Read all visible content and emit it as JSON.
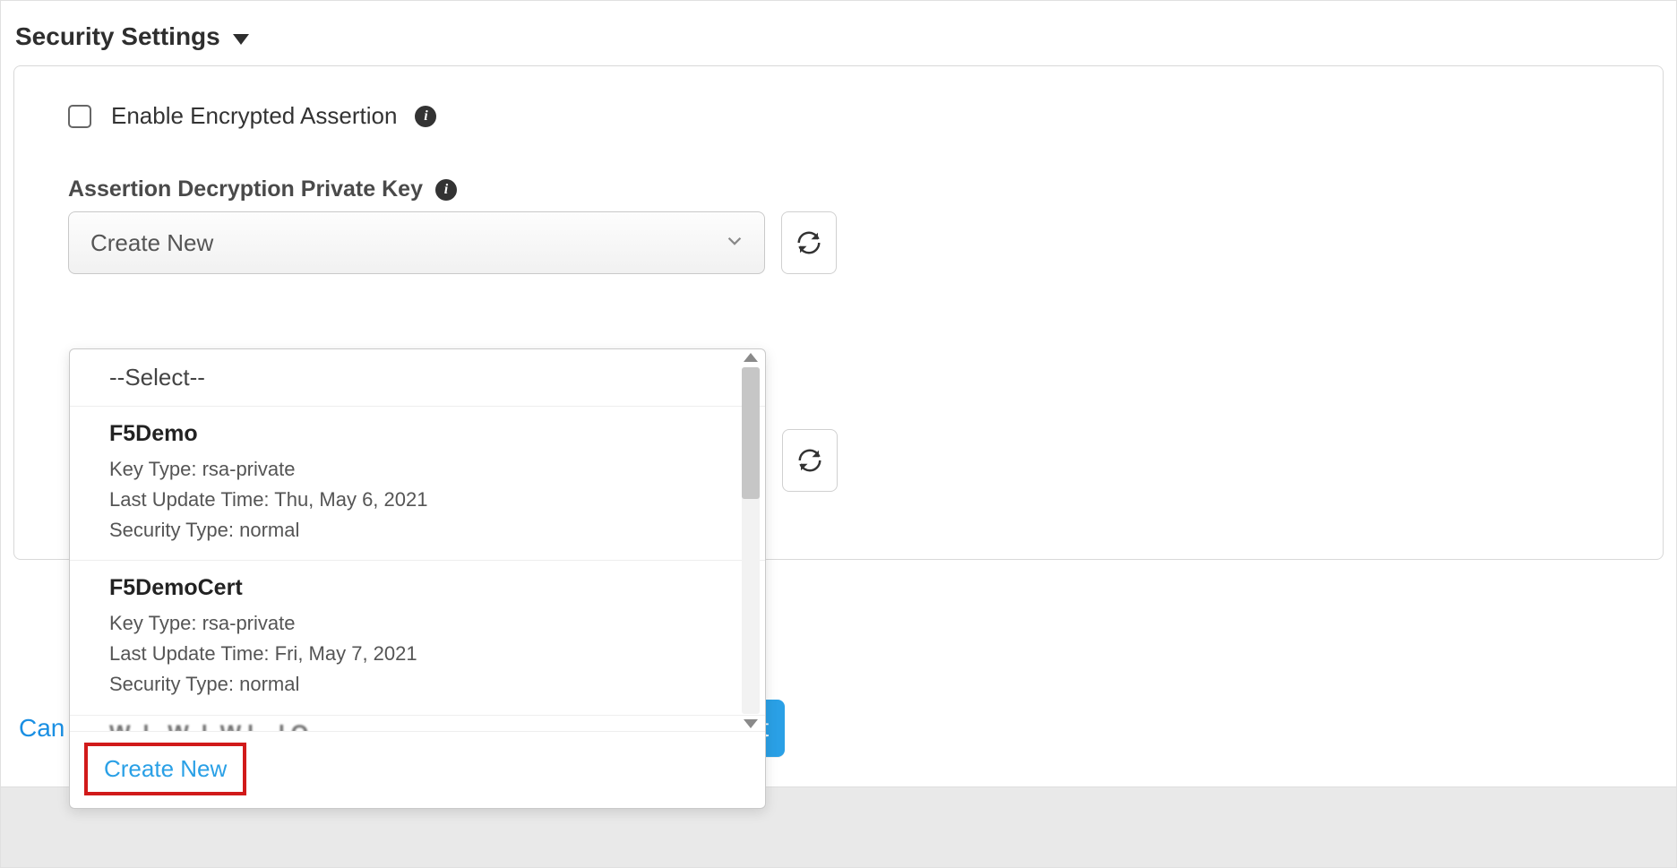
{
  "section": {
    "title": "Security Settings"
  },
  "checkbox": {
    "label": "Enable Encrypted Assertion"
  },
  "field": {
    "label": "Assertion Decryption Private Key"
  },
  "select": {
    "value": "Create New",
    "placeholder_option": "--Select--"
  },
  "options": [
    {
      "name": "F5Demo",
      "key_type_label": "Key Type:",
      "key_type": "rsa-private",
      "last_update_label": "Last Update Time:",
      "last_update": "Thu, May 6, 2021",
      "security_type_label": "Security Type:",
      "security_type": "normal"
    },
    {
      "name": "F5DemoCert",
      "key_type_label": "Key Type:",
      "key_type": "rsa-private",
      "last_update_label": "Last Update Time:",
      "last_update": "Fri, May 7, 2021",
      "security_type_label": "Security Type:",
      "security_type": "normal"
    }
  ],
  "create_new": "Create New",
  "footer": {
    "cancel": "Can",
    "save": "t"
  }
}
